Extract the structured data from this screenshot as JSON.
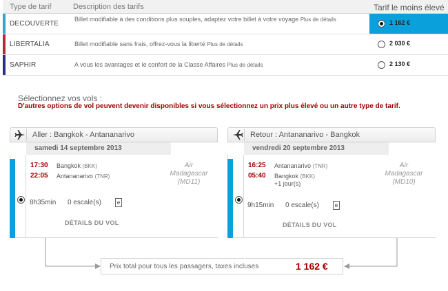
{
  "fare_table": {
    "header": {
      "type": "Type de tarif",
      "description": "Description des tarifs",
      "price": "Tarif le moins élevé"
    },
    "rows": [
      {
        "name": "DECOUVERTE",
        "description": "Billet modifiable à des conditions plus souples, adaptez votre billet à votre voyage",
        "more": "Plus de détails",
        "price": "1 162 €",
        "selected": true,
        "color": "#2aa6d8"
      },
      {
        "name": "LIBERTALIA",
        "description": "Billet modifiable sans frais, offrez-vous la liberté",
        "more": "Plus de détails",
        "price": "2 030 €",
        "selected": false,
        "color": "#b8283a"
      },
      {
        "name": "SAPHIR",
        "description": "A vous les avantages et le confort de la Classe Affaires",
        "more": "Plus de détails",
        "price": "2 130 €",
        "selected": false,
        "color": "#2a2e8c"
      }
    ]
  },
  "selection": {
    "title": "Sélectionnez vos vols :",
    "note": "D'autres options de vol peuvent devenir disponibles si vous sélectionnez un prix plus élevé ou un autre type de tarif."
  },
  "outbound": {
    "title": "Aller : Bangkok - Antananarivo",
    "date": "samedi 14 septembre 2013",
    "dep_time": "17:30",
    "dep_city": "Bangkok",
    "dep_code": "(BKK)",
    "arr_time": "22:05",
    "arr_city": "Antananarivo",
    "arr_code": "(TNR)",
    "carrier_1": "Air",
    "carrier_2": "Madagascar",
    "carrier_3": "(MD11)",
    "duration": "8h35min",
    "stops": "0 escale(s)",
    "e_label": "e",
    "details": "DÉTAILS DU VOL"
  },
  "inbound": {
    "title": "Retour : Antananarivo - Bangkok",
    "date": "vendredi 20 septembre 2013",
    "dep_time": "16:25",
    "dep_city": "Antananarivo",
    "dep_code": "(TNR)",
    "arr_time": "05:40",
    "arr_city": "Bangkok",
    "arr_code": "(BKK)",
    "arr_extra": "+1 jour(s)",
    "carrier_1": "Air",
    "carrier_2": "Madagascar",
    "carrier_3": "(MD10)",
    "duration": "9h15min",
    "stops": "0 escale(s)",
    "e_label": "e",
    "details": "DÉTAILS DU VOL"
  },
  "total": {
    "label": "Prix total pour tous les passagers, taxes incluses",
    "amount": "1 162 €"
  },
  "colors": {
    "accent": "#0aa0dc",
    "price_red": "#a00000"
  }
}
